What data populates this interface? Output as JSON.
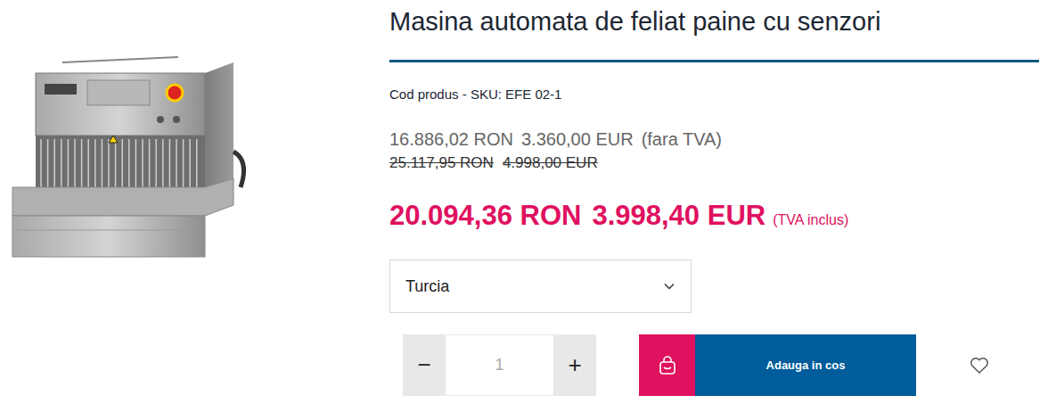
{
  "product": {
    "title": "Masina automata de feliat paine cu senzori",
    "sku": "Cod produs - SKU: EFE 02-1",
    "price_net": {
      "ron": "16.886,02 RON",
      "eur": "3.360,00 EUR",
      "note": "(fara TVA)"
    },
    "price_old": {
      "ron": "25.117,95 RON",
      "eur": "4.998,00 EUR"
    },
    "price_gross": {
      "ron": "20.094,36 RON",
      "eur": "3.998,40 EUR",
      "note": "(TVA inclus)"
    }
  },
  "origin_select": {
    "value": "Turcia"
  },
  "quantity": {
    "minus": "−",
    "value": "1",
    "plus": "+"
  },
  "add_to_cart": {
    "label": "Adauga in cos"
  }
}
